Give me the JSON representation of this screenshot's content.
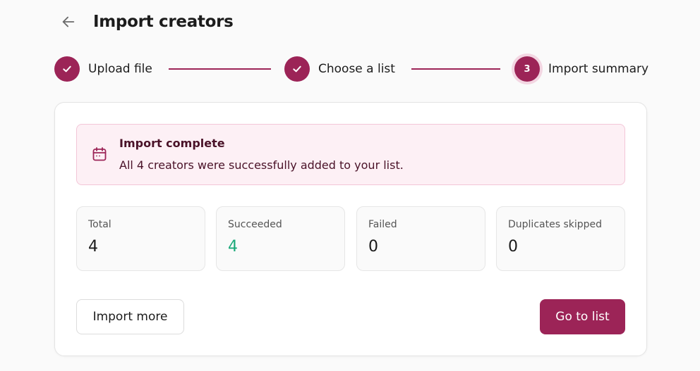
{
  "header": {
    "title": "Import creators",
    "back_icon": "arrow-left-icon"
  },
  "stepper": {
    "steps": [
      {
        "label": "Upload file",
        "status": "completed",
        "marker": ""
      },
      {
        "label": "Choose a list",
        "status": "completed",
        "marker": ""
      },
      {
        "label": "Import summary",
        "status": "current",
        "marker": "3"
      }
    ]
  },
  "alert": {
    "icon": "calendar-icon",
    "title": "Import complete",
    "message": "All 4 creators were successfully added to your list."
  },
  "stats": [
    {
      "label": "Total",
      "value": "4"
    },
    {
      "label": "Succeeded",
      "value": "4"
    },
    {
      "label": "Failed",
      "value": "0"
    },
    {
      "label": "Duplicates skipped",
      "value": "0"
    }
  ],
  "actions": {
    "import_more_label": "Import more",
    "go_to_list_label": "Go to list"
  },
  "colors": {
    "accent": "#9c2457",
    "success": "#1aa979",
    "alert_background": "#fdf0f5"
  }
}
